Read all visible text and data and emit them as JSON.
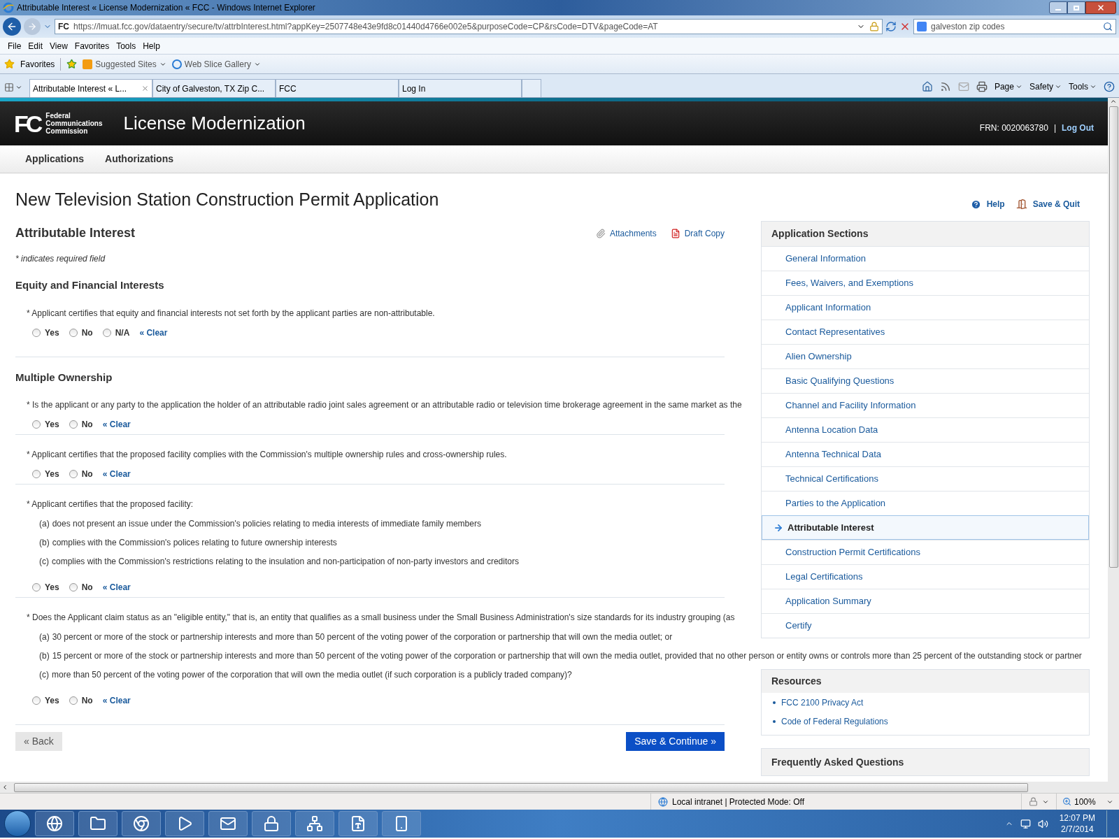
{
  "window": {
    "title": "Attributable Interest « License Modernization « FCC - Windows Internet Explorer"
  },
  "address_bar": {
    "site_icon": "FC",
    "url": "https://lmuat.fcc.gov/dataentry/secure/tv/attrbInterest.html?appKey=2507748e43e9fd8c01440d4766e002e5&purposeCode=CP&rsCode=DTV&pageCode=AT",
    "search_value": "galveston zip codes"
  },
  "menu": [
    "File",
    "Edit",
    "View",
    "Favorites",
    "Tools",
    "Help"
  ],
  "favorites_bar": {
    "favorites": "Favorites",
    "links": [
      "Suggested Sites",
      "Web Slice Gallery"
    ]
  },
  "browser_tabs": [
    {
      "label": "Attributable Interest « L...",
      "selected": true
    },
    {
      "label": "City of Galveston, TX Zip C...",
      "selected": false
    },
    {
      "label": "FCC",
      "selected": false
    },
    {
      "label": "Log In",
      "selected": false
    }
  ],
  "command_bar": [
    "Page",
    "Safety",
    "Tools"
  ],
  "site_header": {
    "logo_mark": "FC",
    "logo_lines": [
      "Federal",
      "Communications",
      "Commission"
    ],
    "title": "License Modernization",
    "frn": "FRN: 0020063780",
    "separator": "|",
    "logout": "Log Out"
  },
  "site_nav": [
    "Applications",
    "Authorizations"
  ],
  "page_title": "New Television Station Construction Permit Application",
  "page_actions": [
    "Help",
    "Save & Quit"
  ],
  "section_title": "Attributable Interest",
  "section_actions": [
    "Attachments",
    "Draft Copy"
  ],
  "required_note": "* indicates required field",
  "groups": [
    {
      "title": "Equity and Financial Interests",
      "questions": [
        {
          "text": "* Applicant certifies that equity and financial interests not set forth by the applicant parties are non-attributable.",
          "options": [
            {
              "label": "Yes",
              "selected": false
            },
            {
              "label": "No",
              "selected": false
            },
            {
              "label": "N/A",
              "selected": false
            }
          ],
          "clear": "« Clear"
        }
      ]
    },
    {
      "title": "Multiple Ownership",
      "questions": [
        {
          "text": "* Is the applicant or any party to the application the holder of an attributable radio joint sales agreement or an attributable radio or television time brokerage agreement in the same market as the",
          "options": [
            {
              "label": "Yes",
              "selected": false
            },
            {
              "label": "No",
              "selected": false
            }
          ],
          "clear": "« Clear"
        },
        {
          "text": "* Applicant certifies that the proposed facility complies with the Commission's multiple ownership rules and cross-ownership rules.",
          "options": [
            {
              "label": "Yes",
              "selected": false
            },
            {
              "label": "No",
              "selected": false
            }
          ],
          "clear": "« Clear"
        },
        {
          "text": "* Applicant certifies that the proposed facility:",
          "sub_items": [
            {
              "marker": "(a)",
              "text": "does not present an issue under the Commission's policies relating to media interests of immediate family members"
            },
            {
              "marker": "(b)",
              "text": "complies with the Commission's polices relating to future ownership interests"
            },
            {
              "marker": "(c)",
              "text": "complies with the Commission's restrictions relating to the insulation and non-participation of non-party investors and creditors"
            }
          ],
          "options": [
            {
              "label": "Yes",
              "selected": false
            },
            {
              "label": "No",
              "selected": false
            }
          ],
          "clear": "« Clear"
        },
        {
          "text": "* Does the Applicant claim status as an \"eligible entity,\" that is, an entity that qualifies as a small business under the Small Business Administration's size standards for its industry grouping (as",
          "sub_items": [
            {
              "marker": "(a)",
              "text": "30 percent or more of the stock or partnership interests and more than 50 percent of the voting power of the corporation or partnership that will own the media outlet; or"
            },
            {
              "marker": "(b)",
              "text": "15 percent or more of the stock or partnership interests and more than 50 percent of the voting power of the corporation or partnership that will own the media outlet, provided that no other person or entity owns or controls more than 25 percent of the outstanding stock or partner"
            },
            {
              "marker": "(c)",
              "text": "more than 50 percent of the voting power of the corporation that will own the media outlet (if such corporation is a publicly traded company)?"
            }
          ],
          "options": [
            {
              "label": "Yes",
              "selected": false
            },
            {
              "label": "No",
              "selected": false
            }
          ],
          "clear": "« Clear"
        }
      ]
    }
  ],
  "footer_buttons": {
    "back": "« Back",
    "continue": "Save & Continue »"
  },
  "sidebar": {
    "title": "Application Sections",
    "items": [
      {
        "label": "General Information",
        "selected": false
      },
      {
        "label": "Fees, Waivers, and Exemptions",
        "selected": false
      },
      {
        "label": "Applicant Information",
        "selected": false
      },
      {
        "label": "Contact Representatives",
        "selected": false
      },
      {
        "label": "Alien Ownership",
        "selected": false
      },
      {
        "label": "Basic Qualifying Questions",
        "selected": false
      },
      {
        "label": "Channel and Facility Information",
        "selected": false
      },
      {
        "label": "Antenna Location Data",
        "selected": false
      },
      {
        "label": "Antenna Technical Data",
        "selected": false
      },
      {
        "label": "Technical Certifications",
        "selected": false
      },
      {
        "label": "Parties to the Application",
        "selected": false
      },
      {
        "label": "Attributable Interest",
        "selected": true
      },
      {
        "label": "Construction Permit Certifications",
        "selected": false
      },
      {
        "label": "Legal Certifications",
        "selected": false
      },
      {
        "label": "Application Summary",
        "selected": false
      },
      {
        "label": "Certify",
        "selected": false
      }
    ]
  },
  "resources": {
    "title": "Resources",
    "links": [
      "FCC 2100 Privacy Act",
      "Code of Federal Regulations"
    ]
  },
  "faq": {
    "title": "Frequently Asked Questions"
  },
  "status_bar": {
    "zone": "Local intranet | Protected Mode: Off",
    "zoom": "100%"
  },
  "taskbar": {
    "time": "12:07 PM",
    "date": "2/7/2014"
  }
}
